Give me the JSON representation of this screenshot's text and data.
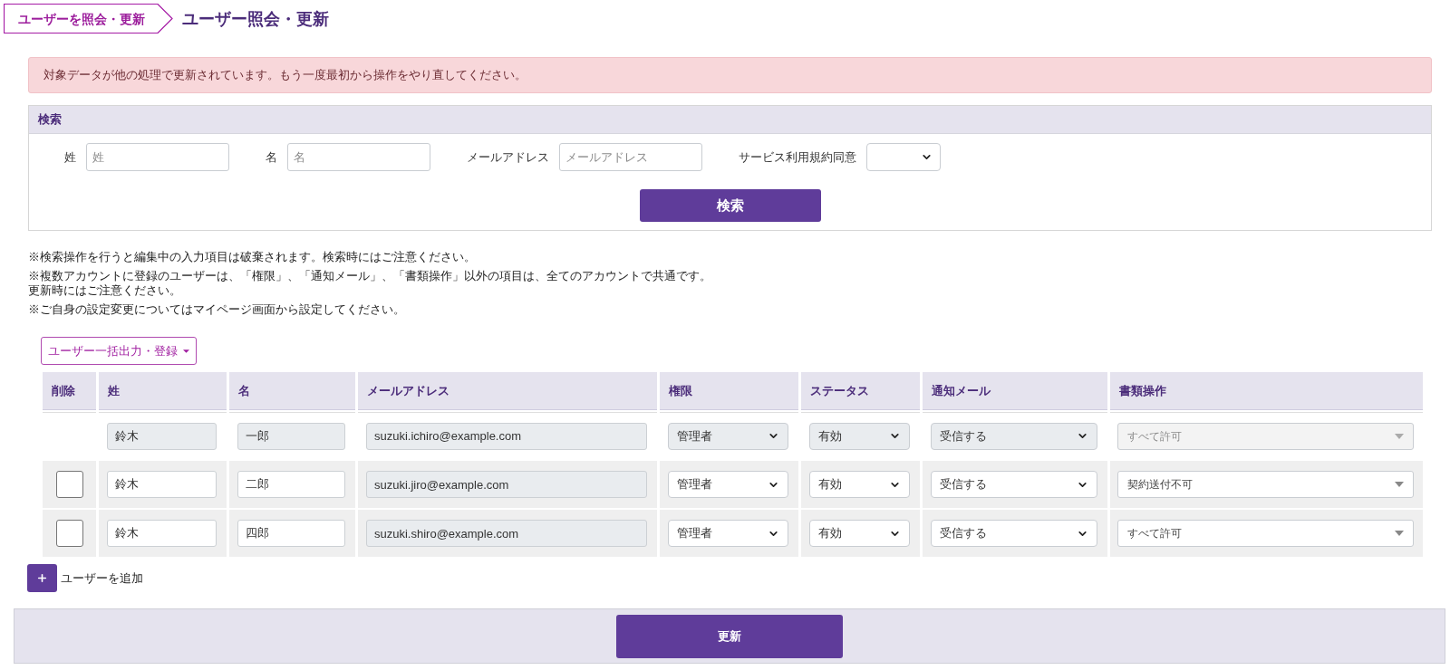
{
  "breadcrumb": {
    "label": "ユーザーを照会・更新"
  },
  "page_title": "ユーザー照会・更新",
  "alert": {
    "message": "対象データが他の処理で更新されています。もう一度最初から操作をやり直してください。"
  },
  "search": {
    "title": "検索",
    "fields": [
      {
        "kind": "text",
        "label": "姓",
        "placeholder": "姓"
      },
      {
        "kind": "text",
        "label": "名",
        "placeholder": "名"
      },
      {
        "kind": "text",
        "label": "メールアドレス",
        "placeholder": "メールアドレス"
      },
      {
        "kind": "select",
        "label": "サービス利用規約同意"
      }
    ],
    "button": "検索"
  },
  "notes": [
    "※検索操作を行うと編集中の入力項目は破棄されます。検索時にはご注意ください。",
    "※複数アカウントに登録のユーザーは、「権限」、「通知メール」、「書類操作」以外の項目は、全てのアカウントで共通です。更新時にはご注意ください。",
    "※ご自身の設定変更についてはマイページ画面から設定してください。"
  ],
  "bulk_menu": {
    "label": "ユーザー一括出力・登録"
  },
  "table": {
    "columns": [
      "削除",
      "姓",
      "名",
      "メールアドレス",
      "権限",
      "ステータス",
      "通知メール",
      "書類操作"
    ],
    "rows": [
      {
        "disabled": true,
        "last_name": "鈴木",
        "first_name": "一郎",
        "email": "suzuki.ichiro@example.com",
        "role": "管理者",
        "status": "有効",
        "notification": "受信する",
        "document_ops": "すべて許可"
      },
      {
        "delete": {
          "checked": false
        },
        "disabled": false,
        "last_name": "鈴木",
        "first_name": "二郎",
        "email": "suzuki.jiro@example.com",
        "role": "管理者",
        "status": "有効",
        "notification": "受信する",
        "document_ops": "契約送付不可"
      },
      {
        "delete": {
          "checked": false
        },
        "disabled": false,
        "last_name": "鈴木",
        "first_name": "四郎",
        "email": "suzuki.shiro@example.com",
        "role": "管理者",
        "status": "有効",
        "notification": "受信する",
        "document_ops": "すべて許可"
      }
    ]
  },
  "add_user": {
    "label": "ユーザーを追加"
  },
  "footer": {
    "button": "更新"
  }
}
